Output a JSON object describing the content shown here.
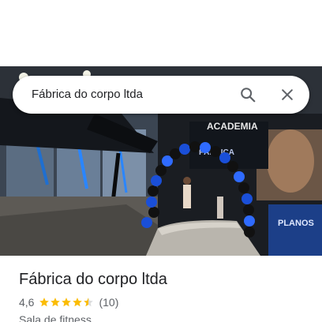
{
  "search": {
    "query": "Fábrica do corpo ltda"
  },
  "place": {
    "name": "Fábrica do corpo ltda",
    "rating": "4,6",
    "stars_filled": 4.5,
    "stars_total": 5,
    "review_count": "(10)",
    "category": "Sala de fitness"
  },
  "hero_photo": {
    "sign_text_top": "ACADEMIA",
    "sign_text_logo": "FÁBRICA",
    "sign_text_side": "PLANOS"
  },
  "colors": {
    "star": "#fbbc04",
    "star_empty": "#dadce0",
    "icon": "#5f6368",
    "balloon_blue": "#1a4fd8",
    "balloon_black": "#111111"
  },
  "icons": {
    "search": "search-icon",
    "close": "close-icon",
    "star": "star-icon"
  }
}
